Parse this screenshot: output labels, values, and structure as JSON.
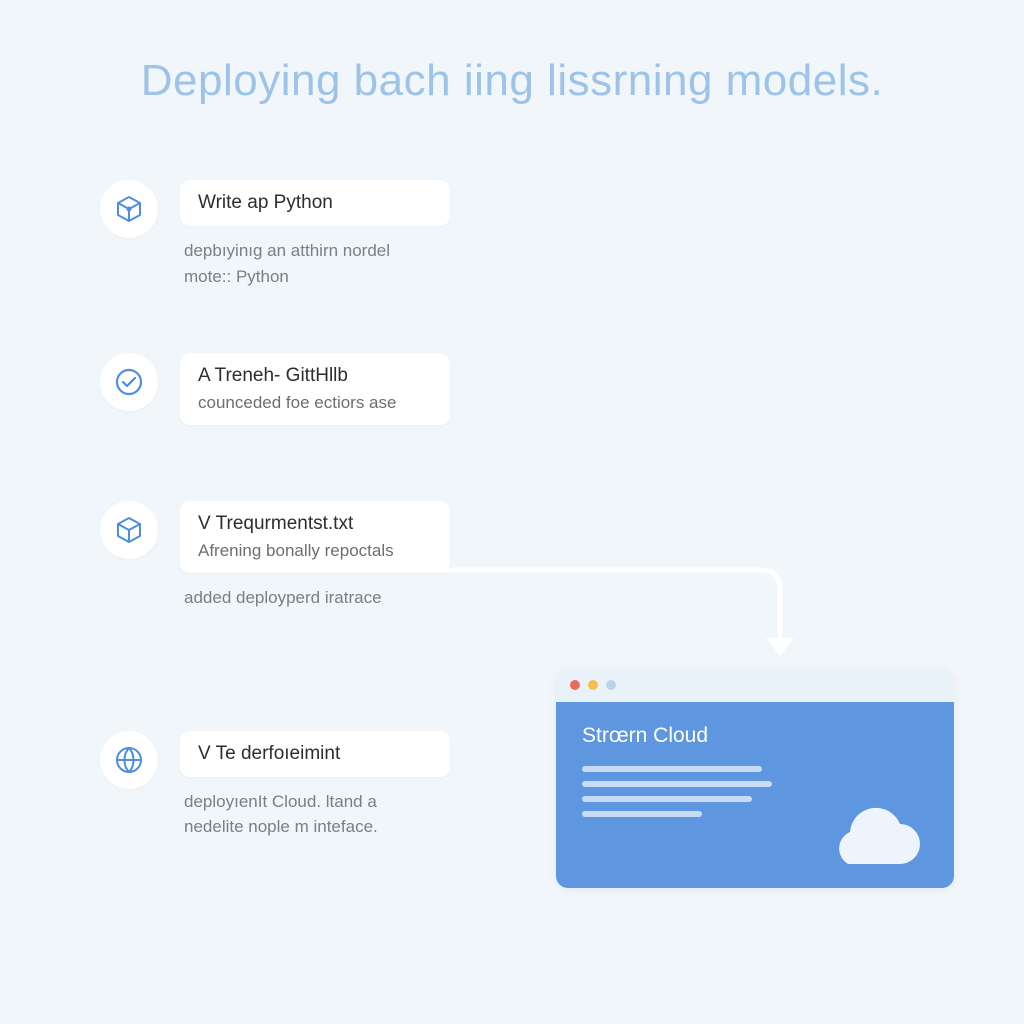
{
  "title": "Deploying bach iing lissrning models.",
  "steps": [
    {
      "icon": "cube-icon",
      "card_title": "Write ap Python",
      "desc_line1": "depbıyinıg an atthirn nordel",
      "desc_line2": "mote:: Python"
    },
    {
      "icon": "check-circle-icon",
      "card_title": "A Treneh- GittHllb",
      "card_sub": "counceded foe ectiors ase"
    },
    {
      "icon": "cube-outline-icon",
      "card_title": "V Trequrmentst.txt",
      "card_sub": "Afrening bonally repoctals",
      "desc_line1": "added deployperd iratrace"
    },
    {
      "icon": "globe-icon",
      "card_title": "V Te derfoıeimint",
      "desc_line1": "deployıenIt Cloud. ltand a",
      "desc_line2": "nedelite nople m inteface."
    }
  ],
  "browser": {
    "title": "Strœrn Cloud"
  },
  "colors": {
    "accent": "#5e97e0",
    "iconStroke": "#4e8ee0"
  }
}
